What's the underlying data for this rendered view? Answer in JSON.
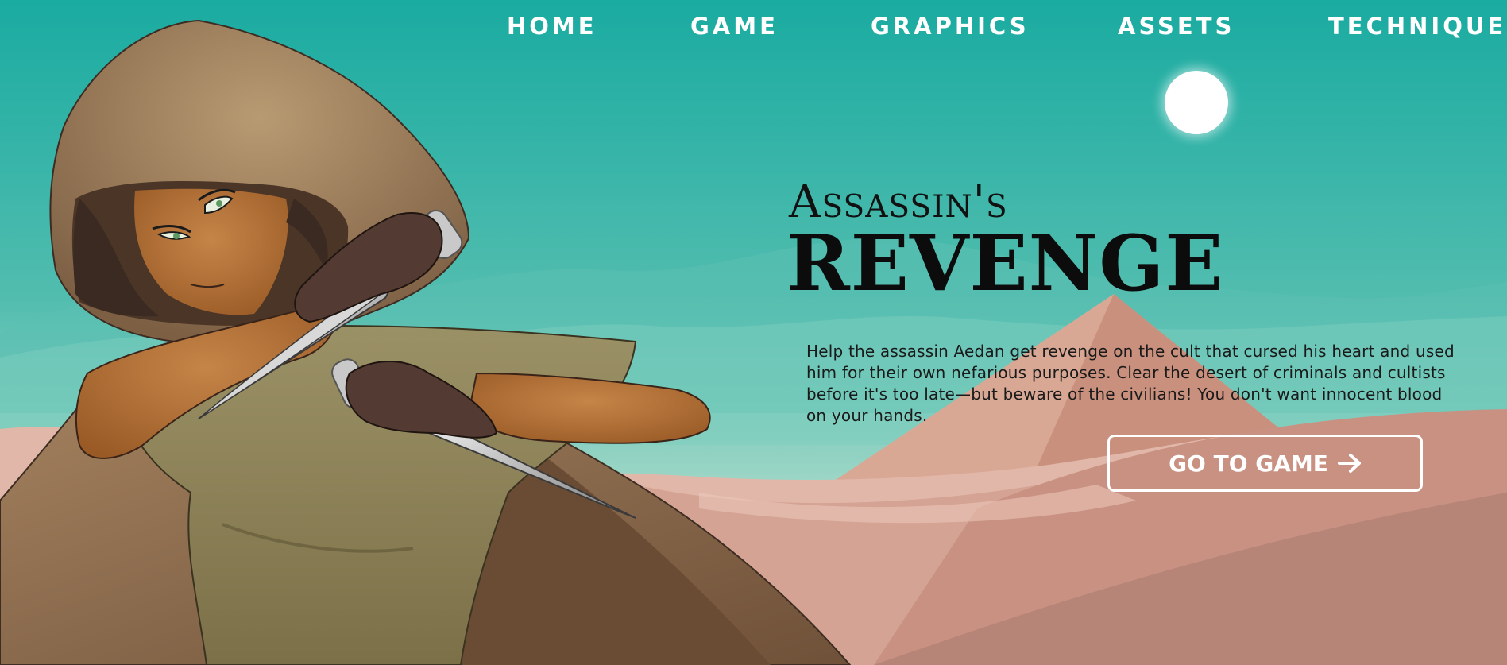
{
  "nav": {
    "items": [
      {
        "label": "HOME"
      },
      {
        "label": "GAME"
      },
      {
        "label": "GRAPHICS"
      },
      {
        "label": "ASSETS"
      },
      {
        "label": "TECHNIQUE"
      }
    ]
  },
  "hero": {
    "title_top": "Assassin's",
    "title_main": "REVENGE",
    "description": "Help the assassin Aedan get revenge on the cult that cursed his heart and used him for their own nefarious purposes. Clear the desert of criminals and cultists before it's too late—but beware of the civilians! You don't want innocent blood on your hands.",
    "cta_label": "GO TO GAME",
    "cta_icon": "arrow-right-icon"
  },
  "colors": {
    "sky_top": "#1cada3",
    "sky_bottom": "#bfe4d7",
    "sand": "#d4a393",
    "pyramid": "#d8a592",
    "cloak": "#8d6a4a",
    "tunic": "#8f8559",
    "skin": "#b06d33",
    "glove": "#533a32",
    "text": "#111111",
    "nav_text": "#ffffff"
  }
}
